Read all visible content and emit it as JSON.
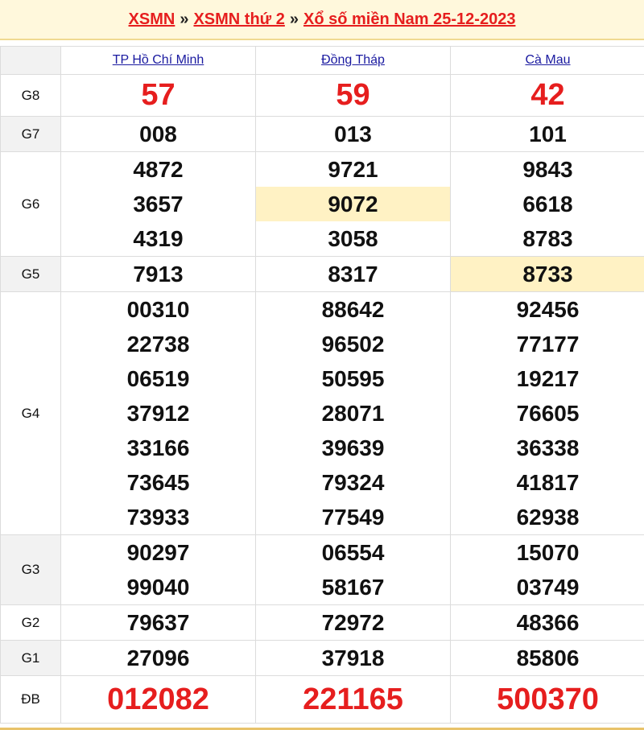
{
  "header": {
    "link1": "XSMN",
    "sep1": "»",
    "link2": "XSMN thứ 2",
    "sep2": "»",
    "link3": "Xổ số miền Nam 25-12-2023"
  },
  "provinces": [
    "TP Hồ Chí Minh",
    "Đồng Tháp",
    "Cà Mau"
  ],
  "prizes": [
    {
      "label": "G8",
      "values": [
        [
          "57"
        ],
        [
          "59"
        ],
        [
          "42"
        ]
      ]
    },
    {
      "label": "G7",
      "values": [
        [
          "008"
        ],
        [
          "013"
        ],
        [
          "101"
        ]
      ]
    },
    {
      "label": "G6",
      "values": [
        [
          "4872",
          "3657",
          "4319"
        ],
        [
          "9721",
          "9072",
          "3058"
        ],
        [
          "9843",
          "6618",
          "8783"
        ]
      ]
    },
    {
      "label": "G5",
      "values": [
        [
          "7913"
        ],
        [
          "8317"
        ],
        [
          "8733"
        ]
      ]
    },
    {
      "label": "G4",
      "values": [
        [
          "00310",
          "22738",
          "06519",
          "37912",
          "33166",
          "73645",
          "73933"
        ],
        [
          "88642",
          "96502",
          "50595",
          "28071",
          "39639",
          "79324",
          "77549"
        ],
        [
          "92456",
          "77177",
          "19217",
          "76605",
          "36338",
          "41817",
          "62938"
        ]
      ]
    },
    {
      "label": "G3",
      "values": [
        [
          "90297",
          "99040"
        ],
        [
          "06554",
          "58167"
        ],
        [
          "15070",
          "03749"
        ]
      ]
    },
    {
      "label": "G2",
      "values": [
        [
          "79637"
        ],
        [
          "72972"
        ],
        [
          "48366"
        ]
      ]
    },
    {
      "label": "G1",
      "values": [
        [
          "27096"
        ],
        [
          "37918"
        ],
        [
          "85806"
        ]
      ]
    },
    {
      "label": "ĐB",
      "values": [
        [
          "012082"
        ],
        [
          "221165"
        ],
        [
          "500370"
        ]
      ]
    }
  ]
}
